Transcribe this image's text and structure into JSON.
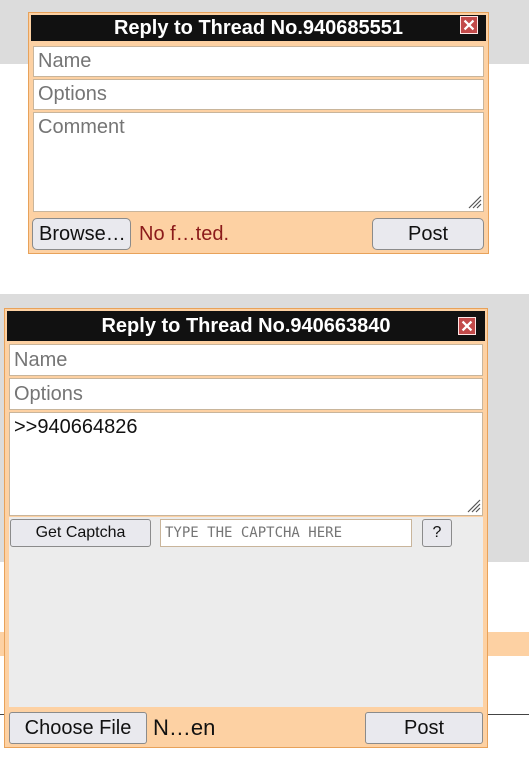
{
  "form1": {
    "title": "Reply to Thread No.940685551",
    "name_placeholder": "Name",
    "options_placeholder": "Options",
    "comment_placeholder": "Comment",
    "browse_label": "Browse…",
    "file_status": "No f…ted.",
    "post_label": "Post"
  },
  "form2": {
    "title": "Reply to Thread No.940663840",
    "name_placeholder": "Name",
    "options_placeholder": "Options",
    "comment_value": ">>940664826",
    "captcha_button": "Get Captcha",
    "captcha_placeholder": "TYPE THE CAPTCHA HERE",
    "help_label": "?",
    "choose_file_label": "Choose File",
    "file_status": "N…en",
    "post_label": "Post"
  },
  "colors": {
    "panel_bg": "#fdd1a3",
    "panel_border": "#e8a25a",
    "title_bg": "#111111",
    "close_bg": "#c24a4a",
    "file_status_color": "#8b1a1a"
  }
}
